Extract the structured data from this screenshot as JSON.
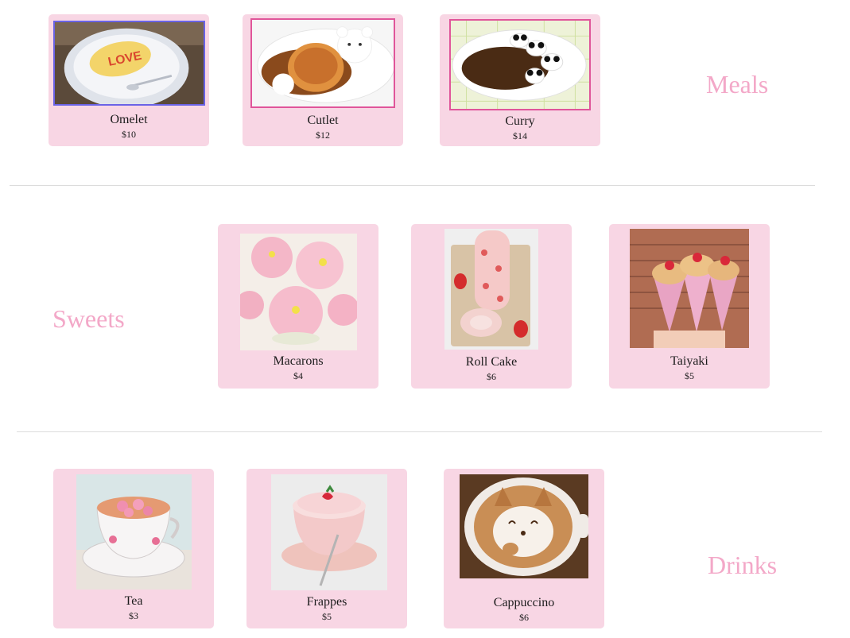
{
  "sections": {
    "meals": {
      "title": "Meals",
      "items": [
        {
          "name": "Omelet",
          "price": "$10",
          "image": "omelet-love-photo"
        },
        {
          "name": "Cutlet",
          "price": "$12",
          "image": "bear-cutlet-curry-photo"
        },
        {
          "name": "Curry",
          "price": "$14",
          "image": "panda-curry-photo"
        }
      ]
    },
    "sweets": {
      "title": "Sweets",
      "items": [
        {
          "name": "Macarons",
          "price": "$4",
          "image": "flower-macarons-photo"
        },
        {
          "name": "Roll Cake",
          "price": "$6",
          "image": "strawberry-roll-cake-photo"
        },
        {
          "name": "Taiyaki",
          "price": "$5",
          "image": "taiyaki-ice-cream-photo"
        }
      ]
    },
    "drinks": {
      "title": "Drinks",
      "items": [
        {
          "name": "Tea",
          "price": "$3",
          "image": "flower-tea-cup-photo"
        },
        {
          "name": "Frappes",
          "price": "$5",
          "image": "strawberry-frappe-photo"
        },
        {
          "name": "Cappuccino",
          "price": "$6",
          "image": "shiba-latte-art-photo"
        }
      ]
    }
  },
  "colors": {
    "card_bg": "#f8d6e4",
    "section_title": "#f3a8c8",
    "divider": "#dcdcdc"
  }
}
